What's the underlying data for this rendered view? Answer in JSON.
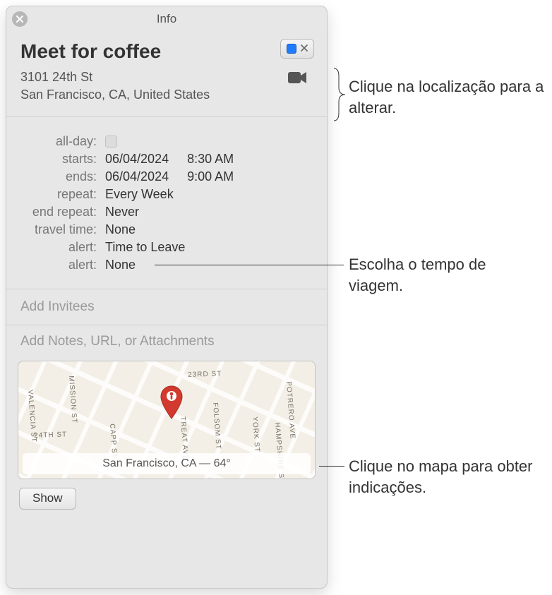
{
  "window": {
    "title": "Info"
  },
  "header": {
    "event_title": "Meet for coffee",
    "location_line1": "3101 24th St",
    "location_line2": "San Francisco, CA, United States",
    "calendar_color": "#1f7cff"
  },
  "details": {
    "labels": {
      "allday": "all-day:",
      "starts": "starts:",
      "ends": "ends:",
      "repeat": "repeat:",
      "end_repeat": "end repeat:",
      "travel_time": "travel time:",
      "alert1": "alert:",
      "alert2": "alert:"
    },
    "values": {
      "allday_checked": false,
      "starts_date": "06/04/2024",
      "starts_time": "8:30 AM",
      "ends_date": "06/04/2024",
      "ends_time": "9:00 AM",
      "repeat": "Every Week",
      "end_repeat": "Never",
      "travel_time": "None",
      "alert1": "Time to Leave",
      "alert2": "None"
    }
  },
  "invitees": {
    "placeholder": "Add Invitees"
  },
  "notes": {
    "placeholder": "Add Notes, URL, or Attachments"
  },
  "map": {
    "caption": "San Francisco, CA — 64°",
    "streets": {
      "top": "23RD ST",
      "left": "24TH ST",
      "v1": "VALENCIA ST",
      "v2": "MISSION ST",
      "v3": "CAPP ST",
      "v4": "TREAT AVE",
      "v5": "FOLSOM ST",
      "v6": "YORK ST",
      "v7": "POTRERO AVE",
      "v8": "HAMPSHIRE ST"
    }
  },
  "footer": {
    "show_label": "Show"
  },
  "callouts": {
    "location": "Clique na localização para a alterar.",
    "travel": "Escolha o tempo de viagem.",
    "map": "Clique no mapa para obter indicações."
  }
}
